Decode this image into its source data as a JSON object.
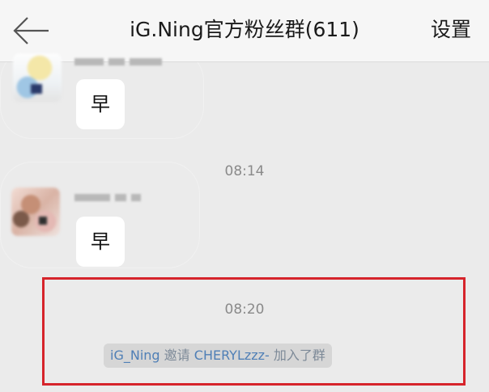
{
  "header": {
    "title": "iG.Ning官方粉丝群(611)",
    "settings_label": "设置",
    "back_icon": "arrow-left-icon"
  },
  "messages": [
    {
      "text": "早"
    },
    {
      "text": "早"
    }
  ],
  "timestamps": [
    "08:14",
    "08:20"
  ],
  "system_notice": {
    "inviter": "iG_Ning",
    "verb": "邀请",
    "invitee": "CHERYLzzz-",
    "action": "加入了群"
  },
  "colors": {
    "background": "#ebebeb",
    "header_bg": "#f6f6f6",
    "bubble_bg": "#ffffff",
    "highlight_border": "#d6242b",
    "link": "#4f7fb6"
  }
}
